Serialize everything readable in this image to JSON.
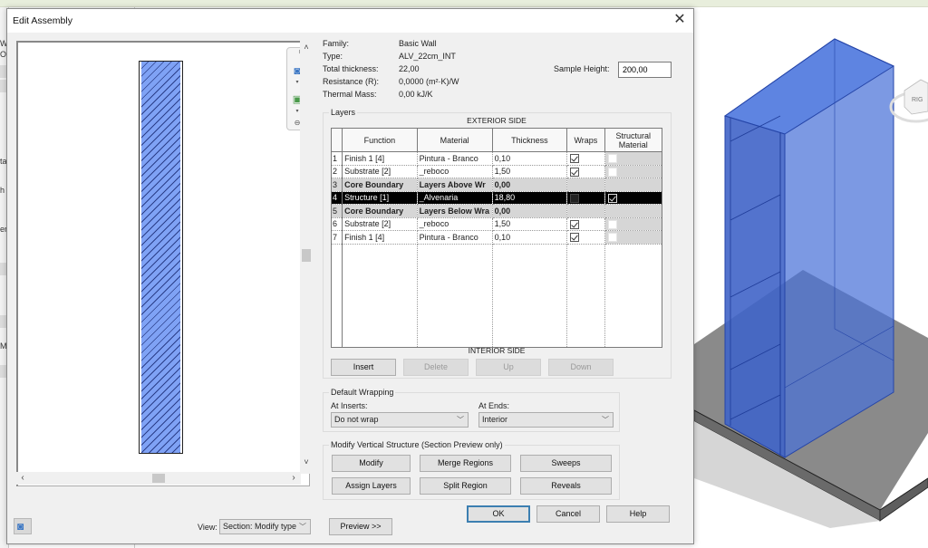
{
  "background": {
    "left_panel_fragments": [
      "W",
      "Oc",
      "ta",
      "h",
      "er",
      "M"
    ]
  },
  "dialog": {
    "title": "Edit Assembly",
    "close_icon": "close-icon"
  },
  "info": {
    "family_label": "Family:",
    "family_value": "Basic Wall",
    "type_label": "Type:",
    "type_value": "ALV_22cm_INT",
    "total_thickness_label": "Total thickness:",
    "total_thickness_value": "22,00",
    "resistance_label": "Resistance (R):",
    "resistance_value": "0,0000 (m²·K)/W",
    "thermal_mass_label": "Thermal Mass:",
    "thermal_mass_value": "0,00 kJ/K",
    "sample_height_label": "Sample Height:",
    "sample_height_value": "200,00"
  },
  "layers": {
    "group_label": "Layers",
    "exterior_label": "EXTERIOR SIDE",
    "interior_label": "INTERIOR SIDE",
    "columns": [
      "",
      "Function",
      "Material",
      "Thickness",
      "Wraps",
      "Structural Material"
    ],
    "rows": [
      {
        "num": "1",
        "function": "Finish 1 [4]",
        "material": "Pintura - Branco",
        "thickness": "0,10",
        "wraps": true,
        "structural": false,
        "type": "normal"
      },
      {
        "num": "2",
        "function": "Substrate [2]",
        "material": "_reboco",
        "thickness": "1,50",
        "wraps": true,
        "structural": false,
        "type": "normal"
      },
      {
        "num": "3",
        "function": "Core Boundary",
        "material": "Layers Above Wr",
        "thickness": "0,00",
        "type": "core"
      },
      {
        "num": "4",
        "function": "Structure [1]",
        "material": "_Alvenaria",
        "thickness": "18,80",
        "wraps": false,
        "structural": true,
        "type": "selected"
      },
      {
        "num": "5",
        "function": "Core Boundary",
        "material": "Layers Below Wra",
        "thickness": "0,00",
        "type": "core"
      },
      {
        "num": "6",
        "function": "Substrate [2]",
        "material": "_reboco",
        "thickness": "1,50",
        "wraps": true,
        "structural": false,
        "type": "normal"
      },
      {
        "num": "7",
        "function": "Finish 1 [4]",
        "material": "Pintura - Branco",
        "thickness": "0,10",
        "wraps": true,
        "structural": false,
        "type": "normal"
      }
    ],
    "buttons": {
      "insert": "Insert",
      "delete": "Delete",
      "up": "Up",
      "down": "Down"
    }
  },
  "wrapping": {
    "group_label": "Default Wrapping",
    "at_inserts_label": "At Inserts:",
    "at_inserts_value": "Do not wrap",
    "at_ends_label": "At Ends:",
    "at_ends_value": "Interior"
  },
  "vertical": {
    "group_label": "Modify Vertical Structure (Section Preview only)",
    "buttons": {
      "modify": "Modify",
      "merge": "Merge Regions",
      "sweeps": "Sweeps",
      "assign": "Assign Layers",
      "split": "Split Region",
      "reveals": "Reveals"
    }
  },
  "footer": {
    "ok": "OK",
    "cancel": "Cancel",
    "help": "Help",
    "preview": "Preview >>",
    "view_label": "View:",
    "view_value": "Section: Modify type"
  },
  "viewcube": {
    "face_label": "RIG"
  }
}
